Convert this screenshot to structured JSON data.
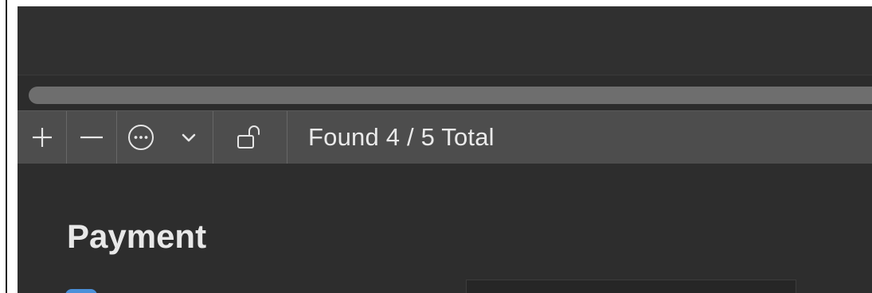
{
  "toolbar": {
    "add_icon": "plus-icon",
    "remove_icon": "minus-icon",
    "more_icon": "ellipsis-circle-icon",
    "dropdown_icon": "chevron-down-icon",
    "lock_icon": "unlock-icon",
    "status": "Found 4 / 5 Total"
  },
  "content": {
    "section_title": "Payment"
  },
  "colors": {
    "background": "#2f2f2f",
    "toolbar": "#4d4d4d",
    "scroll_thumb": "#6e6e6e",
    "accent": "#4a90d9"
  }
}
